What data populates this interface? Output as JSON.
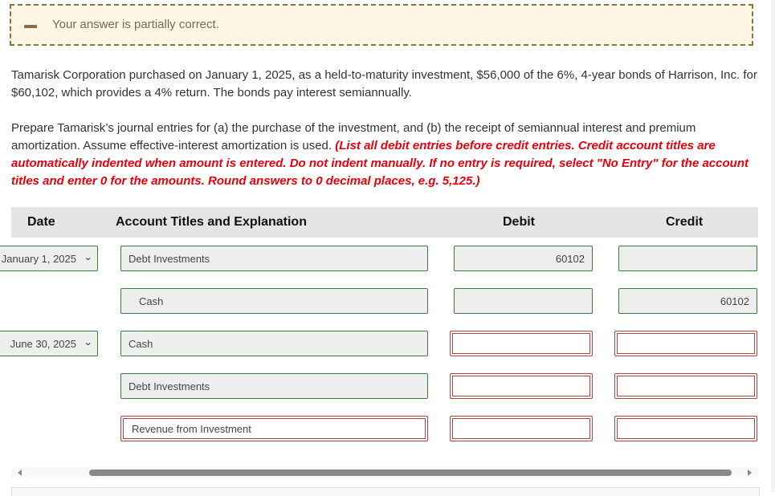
{
  "feedback": {
    "status": "partial",
    "message": "Your answer is partially correct."
  },
  "problem": {
    "text": "Tamarisk Corporation purchased on January 1, 2025, as a held-to-maturity investment, $56,000 of the 6%, 4-year bonds of Harrison, Inc. for $60,102, which provides a 4% return. The bonds pay interest semiannually."
  },
  "instructions": {
    "text": "Prepare Tamarisk’s journal entries for (a) the purchase of the investment, and (b) the receipt of semiannual interest and premium amortization. Assume effective-interest amortization is used. ",
    "note": "(List all debit entries before credit entries. Credit account titles are automatically indented when amount is entered. Do not indent manually. If no entry is required, select \"No Entry\" for the account titles and enter 0 for the amounts. Round answers to 0 decimal places, e.g. 5,125.)"
  },
  "table": {
    "headers": {
      "date": "Date",
      "account": "Account Titles and Explanation",
      "debit": "Debit",
      "credit": "Credit"
    },
    "rows": [
      {
        "date": "January 1, 2025",
        "account": "Debt Investments",
        "debit": "60102",
        "credit": "",
        "account_status": "correct",
        "debit_status": "correct",
        "credit_status": "correct",
        "indented": false
      },
      {
        "date": "",
        "account": "Cash",
        "debit": "",
        "credit": "60102",
        "account_status": "correct",
        "debit_status": "correct",
        "credit_status": "correct",
        "indented": true
      },
      {
        "date": "June 30, 2025",
        "account": "Cash",
        "debit": "",
        "credit": "",
        "account_status": "correct",
        "debit_status": "incorrect",
        "credit_status": "incorrect",
        "indented": false
      },
      {
        "date": "",
        "account": "Debt Investments",
        "debit": "",
        "credit": "",
        "account_status": "correct",
        "debit_status": "incorrect",
        "credit_status": "incorrect",
        "indented": false
      },
      {
        "date": "",
        "account": "Revenue from Investment",
        "debit": "",
        "credit": "",
        "account_status": "incorrect",
        "debit_status": "incorrect",
        "credit_status": "incorrect",
        "indented": false
      }
    ]
  },
  "colors": {
    "correct_border": "#3d7a3d",
    "incorrect_border": "#b04444",
    "instruction_red": "#e8000b",
    "feedback_bg": "#fcf6e3",
    "feedback_border": "#8e7244"
  }
}
